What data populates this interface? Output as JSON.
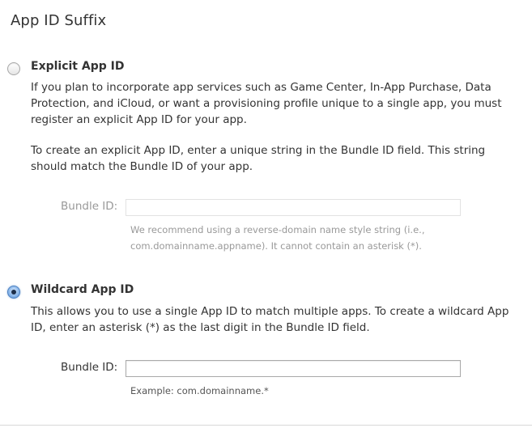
{
  "section": {
    "title": "App ID Suffix"
  },
  "explicit": {
    "title": "Explicit App ID",
    "selected": false,
    "description_1": "If you plan to incorporate app services such as Game Center, In-App Purchase, Data Protection, and iCloud, or want a provisioning profile unique to a single app, you must register an explicit App ID for your app.",
    "description_2": "To create an explicit App ID, enter a unique string in the Bundle ID field. This string should match the Bundle ID of your app.",
    "field_label": "Bundle ID:",
    "field_value": "",
    "field_enabled": false,
    "hint": "We recommend using a reverse-domain name style string (i.e., com.domainname.appname). It cannot contain an asterisk (*)."
  },
  "wildcard": {
    "title": "Wildcard App ID",
    "selected": true,
    "description": "This allows you to use a single App ID to match multiple apps. To create a wildcard App ID, enter an asterisk (*) as the last digit in the Bundle ID field.",
    "field_label": "Bundle ID:",
    "field_value": "",
    "field_enabled": true,
    "hint": "Example: com.domainname.*"
  },
  "colors": {
    "text": "#333333",
    "disabled_text": "#999999",
    "radio_accent": "#5f95d6"
  }
}
